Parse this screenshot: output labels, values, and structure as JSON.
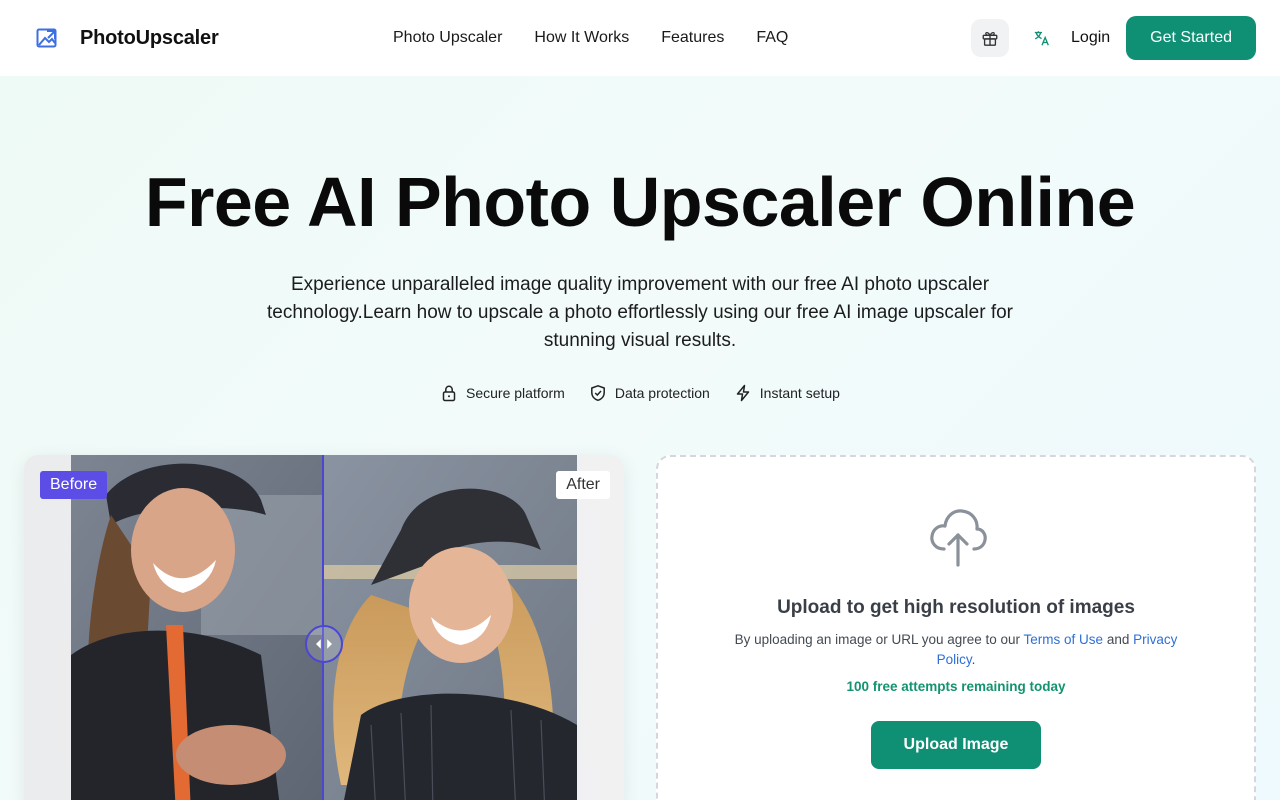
{
  "header": {
    "brand_name": "PhotoUpscaler",
    "nav": [
      "Photo Upscaler",
      "How It Works",
      "Features",
      "FAQ"
    ],
    "login_label": "Login",
    "cta_label": "Get Started",
    "gift_icon": "gift-icon",
    "language_icon": "translate-icon"
  },
  "hero": {
    "title": "Free AI Photo Upscaler Online",
    "description": "Experience unparalleled image quality improvement with our free AI photo upscaler technology.Learn how to upscale a photo effortlessly using our free AI image upscaler for stunning visual results.",
    "badges": [
      {
        "label": "Secure platform",
        "icon": "lock-icon"
      },
      {
        "label": "Data protection",
        "icon": "shield-check-icon"
      },
      {
        "label": "Instant setup",
        "icon": "lightning-icon"
      }
    ]
  },
  "comparison": {
    "before_label": "Before",
    "after_label": "After",
    "slider_position": 0.5
  },
  "upload": {
    "title": "Upload to get high resolution of images",
    "terms_prefix": "By uploading an image or URL you agree to our ",
    "terms_link": "Terms of Use",
    "terms_and": " and ",
    "privacy_link": "Privacy Policy",
    "terms_suffix": ".",
    "attempts_text": "100 free attempts remaining today",
    "button_label": "Upload Image",
    "icon": "cloud-upload-icon"
  },
  "colors": {
    "primary": "#0f8f74",
    "before_tag": "#5b4de6",
    "link": "#2f6fd6",
    "attempts": "#13936f"
  }
}
